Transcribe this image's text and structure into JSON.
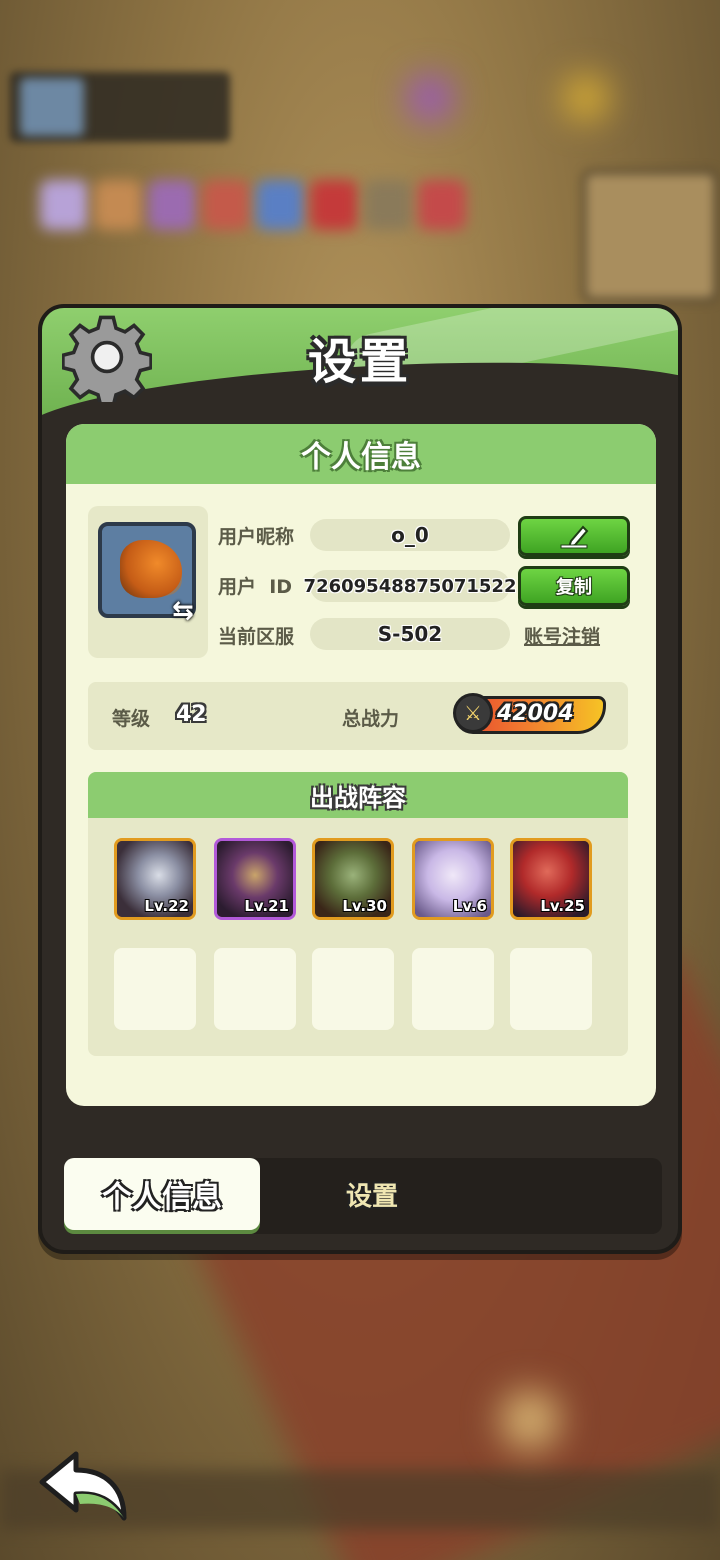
{
  "header": {
    "title": "设置",
    "settings_icon": "gear-icon"
  },
  "profile": {
    "section_title": "个人信息",
    "nickname_label": "用户昵称",
    "nickname_value": "o_0",
    "user_id_label": "用户  ID",
    "user_id_value": "72609548875071522",
    "server_label": "当前区服",
    "server_value": "S-502",
    "edit_icon": "pencil-icon",
    "copy_label": "复制",
    "cancel_account_label": "账号注销",
    "swap_icon": "swap-icon"
  },
  "stats": {
    "level_label": "等级",
    "level_value": "42",
    "power_label": "总战力",
    "power_value": "42004",
    "power_icon": "crossed-swords-icon"
  },
  "lineup": {
    "title": "出战阵容",
    "heroes": [
      {
        "level": "Lv.22",
        "frame": "#e19b1f"
      },
      {
        "level": "Lv.21",
        "frame": "#b25ad9"
      },
      {
        "level": "Lv.30",
        "frame": "#e19b1f"
      },
      {
        "level": "Lv.6",
        "frame": "#e19b1f"
      },
      {
        "level": "Lv.25",
        "frame": "#e19b1f"
      }
    ],
    "empty_slots": 5
  },
  "tabs": {
    "active": "个人信息",
    "inactive": "设置"
  },
  "colors": {
    "accent_green": "#8ccc70",
    "panel_dark": "#2f2a25",
    "card_bg": "#f5f7dc"
  }
}
